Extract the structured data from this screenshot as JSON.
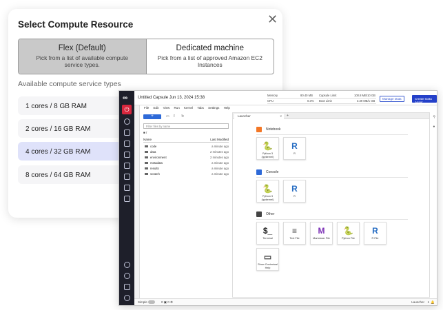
{
  "dialog": {
    "title": "Select Compute Resource",
    "close_glyph": "✕",
    "modes": [
      {
        "title": "Flex (Default)",
        "sub": "Pick from a list of available compute service types.",
        "active": true
      },
      {
        "title": "Dedicated machine",
        "sub": "Pick from a list of approved Amazon EC2 Instances",
        "active": false
      }
    ],
    "available_label": "Available compute service types",
    "options": [
      {
        "label": "1 cores / 8 GB RAM",
        "selected": false
      },
      {
        "label": "2 cores / 16 GB RAM",
        "selected": false
      },
      {
        "label": "4 cores / 32 GB RAM",
        "selected": true
      },
      {
        "label": "8 cores / 64 GB RAM",
        "selected": false
      }
    ]
  },
  "ide": {
    "capsule_title": "Untitled Capsule Jun 13, 2024 15:38",
    "metrics": {
      "memory_label": "Memory",
      "memory_value": "80.40 MB",
      "capsule_limit_label": "Capsule Limit",
      "capsule_limit_value": "100.8 MB/10 GB",
      "cpu_label": "CPU",
      "cpu_value": "0.3%",
      "boot_limit_label": "Boot Limit",
      "boot_limit_value": "3.39 MB/1 GB"
    },
    "manage_data": "Manage Data",
    "create_asset": "Create Data Asset",
    "menu": [
      "File",
      "Edit",
      "View",
      "Run",
      "Kernel",
      "Tabs",
      "Settings",
      "Help"
    ],
    "filebrowser": {
      "new_button": "+",
      "filter_placeholder": "Filter files by name",
      "breadcrumb": "■ /",
      "col_name": "Name",
      "col_modified": "Last Modified",
      "files": [
        {
          "name": "code",
          "modified": "a minute ago"
        },
        {
          "name": "data",
          "modified": "2 minutes ago"
        },
        {
          "name": "environment",
          "modified": "2 minutes ago"
        },
        {
          "name": "metadata",
          "modified": "a minute ago"
        },
        {
          "name": "results",
          "modified": "a minute ago"
        },
        {
          "name": "scratch",
          "modified": "a minute ago"
        }
      ]
    },
    "launcher": {
      "tab_label": "Launcher",
      "tab_close": "×",
      "tab_plus": "+",
      "sections": [
        {
          "title": "Notebook",
          "icon_color": "#f37726",
          "cards": [
            {
              "label": "Python 3 (ipykernel)",
              "glyph": "🐍",
              "glyph_color": "#3572a5",
              "icon": "python-icon"
            },
            {
              "label": "R",
              "glyph": "R",
              "glyph_color": "#276dc3",
              "icon": "r-logo-icon"
            }
          ]
        },
        {
          "title": "Console",
          "icon_color": "#2e6ad8",
          "cards": [
            {
              "label": "Python 3 (ipykernel)",
              "glyph": "🐍",
              "glyph_color": "#3572a5",
              "icon": "python-icon"
            },
            {
              "label": "R",
              "glyph": "R",
              "glyph_color": "#276dc3",
              "icon": "r-logo-icon"
            }
          ]
        },
        {
          "title": "Other",
          "icon_color": "#444444",
          "cards": [
            {
              "label": "Terminal",
              "glyph": "$_",
              "glyph_color": "#222222",
              "icon": "terminal-icon"
            },
            {
              "label": "Text File",
              "glyph": "≡",
              "glyph_color": "#444444",
              "icon": "text-file-icon"
            },
            {
              "label": "Markdown File",
              "glyph": "M",
              "glyph_color": "#7b2fb5",
              "icon": "markdown-icon"
            },
            {
              "label": "Python File",
              "glyph": "🐍",
              "glyph_color": "#3572a5",
              "icon": "python-file-icon"
            },
            {
              "label": "R File",
              "glyph": "R",
              "glyph_color": "#276dc3",
              "icon": "r-file-icon"
            },
            {
              "label": "Show Contextual Help",
              "glyph": "▭",
              "glyph_color": "#444444",
              "icon": "contextual-help-icon"
            }
          ]
        }
      ]
    },
    "status": {
      "mode_label": "Simple",
      "left_counts": "0 ▣ 0 ⚙",
      "right_label": "Launcher",
      "right_count": "1"
    }
  }
}
